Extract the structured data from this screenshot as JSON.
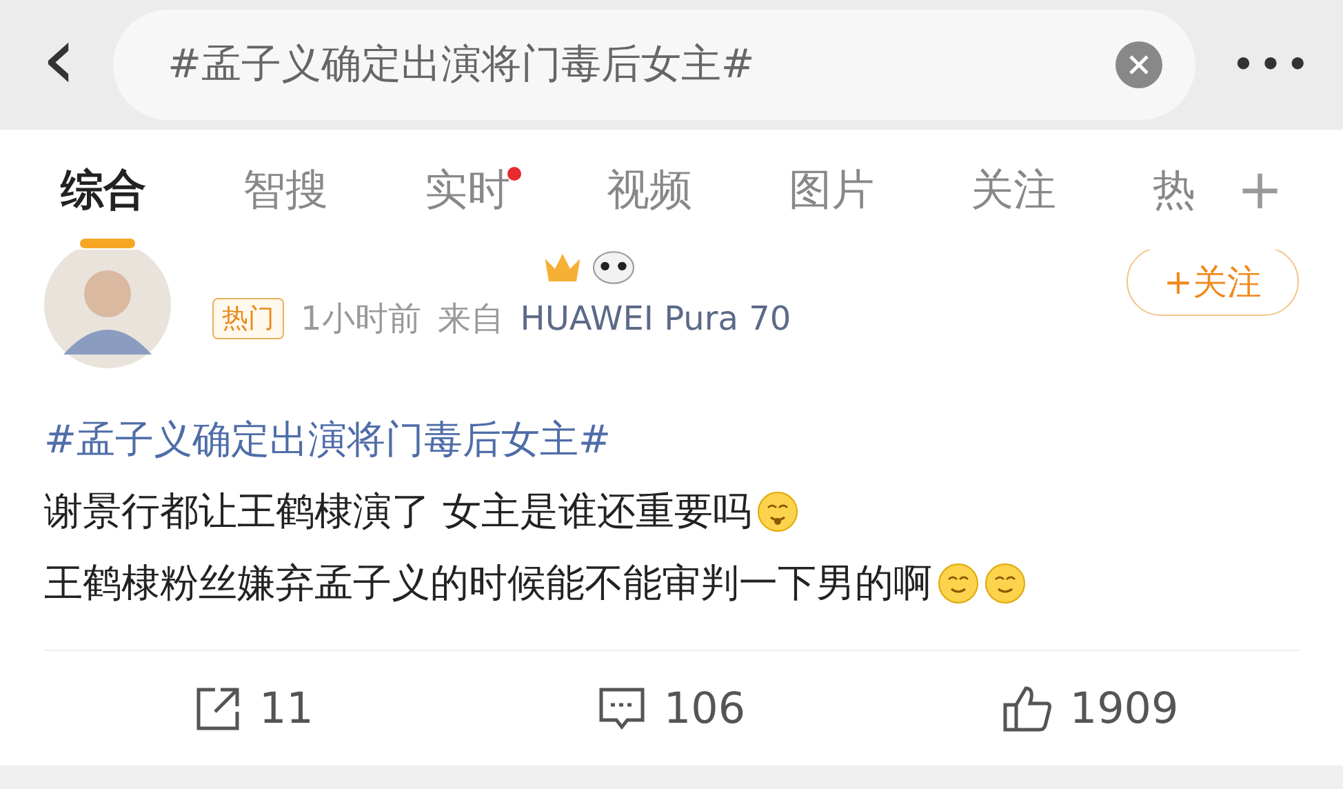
{
  "search": {
    "back": "‹",
    "query": "#孟子义确定出演将门毒后女主#",
    "more": "•••"
  },
  "tabs": [
    {
      "label": "综合",
      "selected": true,
      "dot": false
    },
    {
      "label": "智搜",
      "selected": false,
      "dot": false
    },
    {
      "label": "实时",
      "selected": false,
      "dot": true
    },
    {
      "label": "视频",
      "selected": false,
      "dot": false
    },
    {
      "label": "图片",
      "selected": false,
      "dot": false
    },
    {
      "label": "关注",
      "selected": false,
      "dot": false
    },
    {
      "label": "热",
      "selected": false,
      "dot": false
    }
  ],
  "add_tab": "+",
  "post": {
    "badge": "热门",
    "time": "1小时前",
    "source_prefix": "来自",
    "source": "HUAWEI Pura 70",
    "follow": "+关注",
    "topic": "#孟子义确定出演将门毒后女主#",
    "lines": [
      {
        "text": "谢景行都让王鹤棣演了 女主是谁还重要吗",
        "emojis": [
          {
            "kind": "shy"
          }
        ]
      },
      {
        "text": "王鹤棣粉丝嫌弃孟子义的时候能不能审判一下男的啊",
        "emojis": [
          {
            "kind": "smile"
          },
          {
            "kind": "smile"
          }
        ]
      }
    ],
    "actions": [
      {
        "kind": "repost",
        "count": "11"
      },
      {
        "kind": "comment",
        "count": "106"
      },
      {
        "kind": "like",
        "count": "1909"
      }
    ]
  }
}
